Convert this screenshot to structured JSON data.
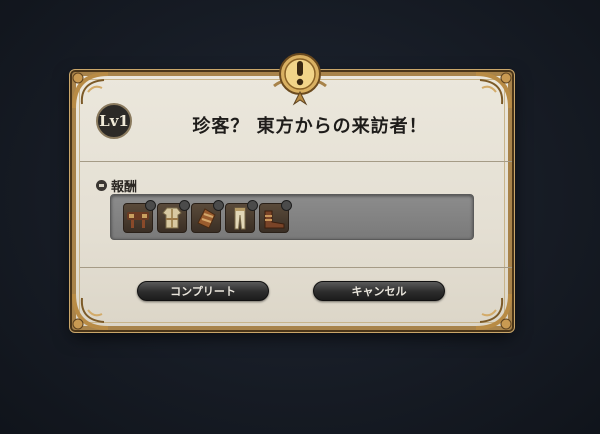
{
  "dialog": {
    "level_badge": "Lv1",
    "title": "珍客？ 東方からの来訪者！",
    "reward_label": "報酬",
    "rewards": [
      {
        "icon": "belt-icon"
      },
      {
        "icon": "robe-icon"
      },
      {
        "icon": "gloves-icon"
      },
      {
        "icon": "trousers-icon"
      },
      {
        "icon": "boots-icon"
      }
    ],
    "buttons": {
      "complete_label": "コンプリート",
      "cancel_label": "キャンセル"
    }
  },
  "colors": {
    "frame_gold": "#a8834a",
    "panel_bg": "#e6e1d6",
    "reward_box": "#808080",
    "button_dark": "#2c2c2c"
  }
}
